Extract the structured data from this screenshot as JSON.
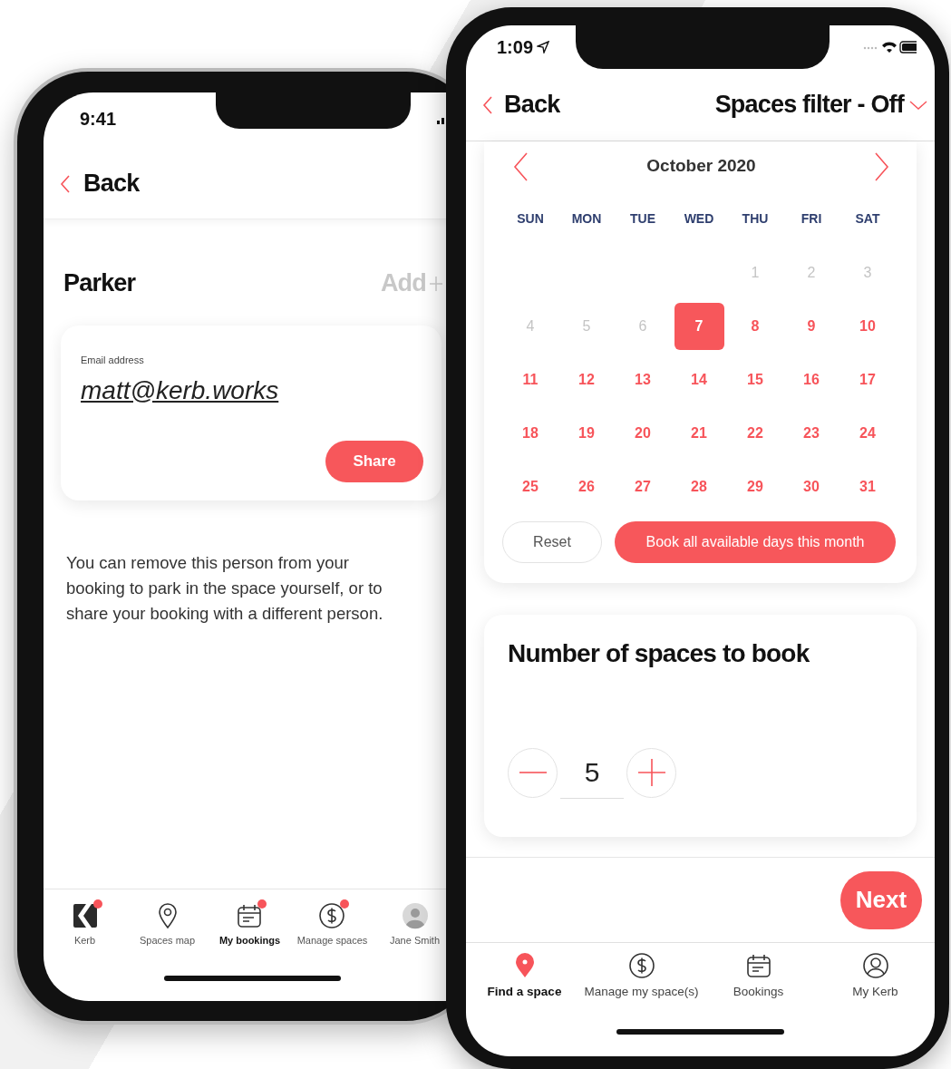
{
  "left_phone": {
    "status_bar": {
      "time": "9:41"
    },
    "header": {
      "back": "Back"
    },
    "title": "Parker",
    "add_action": "Add",
    "email_card": {
      "label": "Email address",
      "value": "matt@kerb.works",
      "button": "Share"
    },
    "message": "You can remove this person from your booking to park in the space yourself, or to share your booking with a different person.",
    "tab_bar": [
      {
        "kind": "logo",
        "label": "Kerb",
        "selected": false,
        "badge": true
      },
      {
        "kind": "pin",
        "label": "Spaces map",
        "selected": false,
        "badge": false
      },
      {
        "kind": "calendar",
        "label": "My bookings",
        "selected": true,
        "badge": true
      },
      {
        "kind": "dollar",
        "label": "Manage spaces",
        "selected": false,
        "badge": true
      },
      {
        "kind": "avatar",
        "label": "Jane Smith",
        "selected": false,
        "badge": false
      }
    ]
  },
  "right_phone": {
    "status_bar": {
      "time": "1:09"
    },
    "header": {
      "back": "Back",
      "filter": "Spaces filter - Off"
    },
    "calendar": {
      "month": "October 2020",
      "weekdays": [
        "SUN",
        "MON",
        "TUE",
        "WED",
        "THU",
        "FRI",
        "SAT"
      ],
      "weeks": [
        {
          "kind": "partial",
          "days": [
            {
              "label": "1",
              "available": false,
              "selected": false
            },
            {
              "label": "2",
              "available": false,
              "selected": false
            },
            {
              "label": "3",
              "available": false,
              "selected": false
            }
          ]
        },
        {
          "kind": "full",
          "days": [
            {
              "label": "4",
              "available": false,
              "selected": false
            },
            {
              "label": "5",
              "available": false,
              "selected": false
            },
            {
              "label": "6",
              "available": false,
              "selected": false
            },
            {
              "label": "7",
              "available": true,
              "selected": true
            },
            {
              "label": "8",
              "available": true,
              "selected": false
            },
            {
              "label": "9",
              "available": true,
              "selected": false
            },
            {
              "label": "10",
              "available": true,
              "selected": false
            }
          ]
        },
        {
          "kind": "full",
          "days": [
            {
              "label": "11",
              "available": true,
              "selected": false
            },
            {
              "label": "12",
              "available": true,
              "selected": false
            },
            {
              "label": "13",
              "available": true,
              "selected": false
            },
            {
              "label": "14",
              "available": true,
              "selected": false
            },
            {
              "label": "15",
              "available": true,
              "selected": false
            },
            {
              "label": "16",
              "available": true,
              "selected": false
            },
            {
              "label": "17",
              "available": true,
              "selected": false
            }
          ]
        },
        {
          "kind": "full",
          "days": [
            {
              "label": "18",
              "available": true,
              "selected": false
            },
            {
              "label": "19",
              "available": true,
              "selected": false
            },
            {
              "label": "20",
              "available": true,
              "selected": false
            },
            {
              "label": "21",
              "available": true,
              "selected": false
            },
            {
              "label": "22",
              "available": true,
              "selected": false
            },
            {
              "label": "23",
              "available": true,
              "selected": false
            },
            {
              "label": "24",
              "available": true,
              "selected": false
            }
          ]
        },
        {
          "kind": "full",
          "days": [
            {
              "label": "25",
              "available": true,
              "selected": false
            },
            {
              "label": "26",
              "available": true,
              "selected": false
            },
            {
              "label": "27",
              "available": true,
              "selected": false
            },
            {
              "label": "28",
              "available": true,
              "selected": false
            },
            {
              "label": "29",
              "available": true,
              "selected": false
            },
            {
              "label": "30",
              "available": true,
              "selected": false
            },
            {
              "label": "31",
              "available": true,
              "selected": false
            }
          ]
        }
      ],
      "reset_button": "Reset",
      "book_all_button": "Book all available days this month"
    },
    "spaces_card": {
      "title": "Number of spaces to book",
      "value": "5"
    },
    "next_button": "Next",
    "tab_bar": [
      {
        "kind": "pin",
        "label": "Find a space",
        "selected": true
      },
      {
        "kind": "dollar",
        "label": "Manage my space(s)",
        "selected": false
      },
      {
        "kind": "calendar",
        "label": "Bookings",
        "selected": false
      },
      {
        "kind": "person",
        "label": "My Kerb",
        "selected": false
      }
    ]
  }
}
